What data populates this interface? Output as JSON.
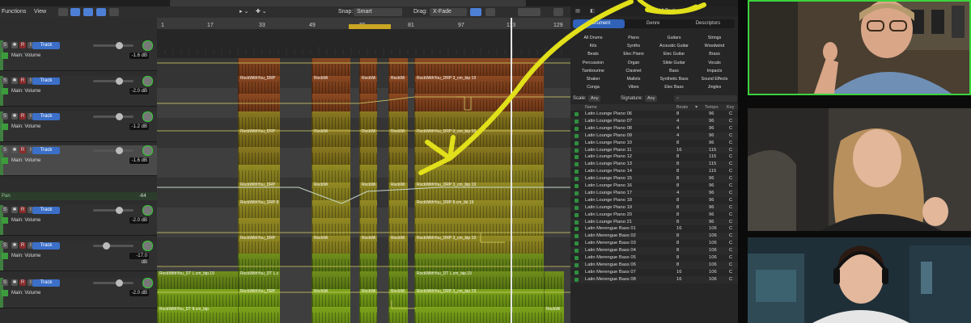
{
  "toolbar": {
    "functions": "Functions",
    "view": "View",
    "snap_label": "Snap:",
    "snap_value": "Smart",
    "drag_label": "Drag:",
    "drag_value": "X-Fade"
  },
  "ruler": {
    "ticks": [
      "1",
      "17",
      "33",
      "49",
      "65",
      "81",
      "97",
      "113",
      "129"
    ]
  },
  "tracks": [
    {
      "label": "Main: Volume",
      "value": "-1.6 dB",
      "button": "Track",
      "selected": false
    },
    {
      "label": "Main: Volume",
      "value": "-2.0 dB",
      "button": "Track",
      "selected": false
    },
    {
      "label": "Main: Volume",
      "value": "-1.2 dB",
      "button": "Track",
      "selected": false
    },
    {
      "label": "Main: Volume",
      "value": "-1.6 dB",
      "button": "Track",
      "selected": true
    },
    {
      "label": "Main: Volume",
      "value": "-2.0 dB",
      "button": "Track",
      "selected": false
    },
    {
      "label": "Main: Volume",
      "value": "-17.0 dB",
      "button": "Track",
      "selected": false
    },
    {
      "label": "Main: Volume",
      "value": "-2.0 dB",
      "button": "Track",
      "selected": false
    }
  ],
  "pan_row": {
    "label": "Pan",
    "value": "-64"
  },
  "regions": {
    "drp": "RockWithYou_DRP",
    "drp_short": "RockWi",
    "drp_cm": "RockWithYou_DRP 3_cm_bip 19",
    "drp_8": "RockWithYou_DRP 8",
    "drp_8cm": "RockWithYou_DRP 8.cm_tbl.19",
    "dt": "RockWithYou_DT L.cm_bip.19",
    "dt_short": "RockWithYou_DT L.c",
    "dt_8": "RockWithYou_DT 8.cm_bip",
    "dt_end": "RockWi"
  },
  "browser": {
    "tab1": "All Packs",
    "seg_instrument": "Instrument",
    "seg_genre": "Genre",
    "seg_descriptors": "Descriptors",
    "grid": [
      [
        "All Drums",
        "Piano",
        "Guitars",
        "Strings"
      ],
      [
        "Kits",
        "Synths",
        "Acoustic Guitar",
        "Woodwind"
      ],
      [
        "Beats",
        "Elec Piano",
        "Elec Guitar",
        "Brass"
      ],
      [
        "Percussion",
        "Organ",
        "Slide Guitar",
        "Vocals"
      ],
      [
        "Tambourine",
        "Clavinet",
        "Bass",
        "Impacts"
      ],
      [
        "Shaker",
        "Mallets",
        "Synthetic Bass",
        "Sound Effects"
      ],
      [
        "Conga",
        "Vibes",
        "Elec Bass",
        "Jingles"
      ]
    ],
    "scale_label": "Scale:",
    "scale_value": "Any",
    "signature_label": "Signature:",
    "signature_value": "Any",
    "columns": {
      "name": "Name",
      "beats": "Beats",
      "tempo": "Tempo",
      "key": "Key"
    },
    "rows": [
      [
        "Latin Lounge Piano 06",
        "8",
        "96",
        "C"
      ],
      [
        "Latin Lounge Piano 07",
        "4",
        "96",
        "C"
      ],
      [
        "Latin Lounge Piano 08",
        "4",
        "96",
        "C"
      ],
      [
        "Latin Lounge Piano 09",
        "4",
        "96",
        "C"
      ],
      [
        "Latin Lounge Piano 10",
        "8",
        "96",
        "C"
      ],
      [
        "Latin Lounge Piano 11",
        "16",
        "115",
        "C"
      ],
      [
        "Latin Lounge Piano 12",
        "8",
        "115",
        "C"
      ],
      [
        "Latin Lounge Piano 13",
        "8",
        "115",
        "C"
      ],
      [
        "Latin Lounge Piano 14",
        "8",
        "115",
        "C"
      ],
      [
        "Latin Lounge Piano 15",
        "8",
        "96",
        "C"
      ],
      [
        "Latin Lounge Piano 16",
        "8",
        "96",
        "C"
      ],
      [
        "Latin Lounge Piano 17",
        "4",
        "96",
        "C"
      ],
      [
        "Latin Lounge Piano 18",
        "8",
        "96",
        "C"
      ],
      [
        "Latin Lounge Piano 19",
        "8",
        "96",
        "C"
      ],
      [
        "Latin Lounge Piano 20",
        "8",
        "96",
        "C"
      ],
      [
        "Latin Lounge Piano 21",
        "8",
        "96",
        "C"
      ],
      [
        "Latin Merengue Bass 01",
        "16",
        "106",
        "C"
      ],
      [
        "Latin Merengue Bass 02",
        "8",
        "106",
        "C"
      ],
      [
        "Latin Merengue Bass 03",
        "8",
        "106",
        "C"
      ],
      [
        "Latin Merengue Bass 04",
        "8",
        "106",
        "C"
      ],
      [
        "Latin Merengue Bass 05",
        "8",
        "106",
        "C"
      ],
      [
        "Latin Merengue Bass 06",
        "8",
        "106",
        "C"
      ],
      [
        "Latin Merengue Bass 07",
        "16",
        "106",
        "C"
      ],
      [
        "Latin Merengue Bass 08",
        "16",
        "106",
        "C"
      ]
    ]
  },
  "annotation_color": "#e1e01a",
  "accent_color": "#3b6fc8"
}
